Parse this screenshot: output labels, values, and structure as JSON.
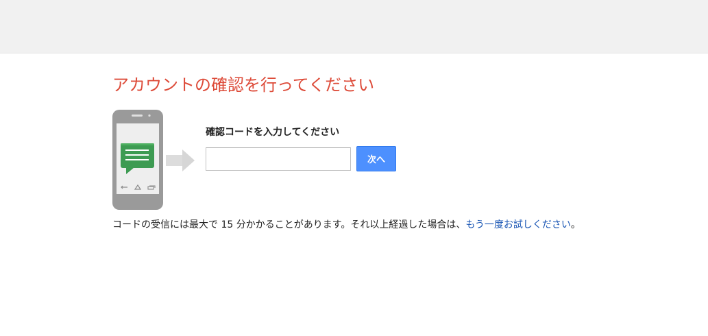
{
  "page": {
    "title": "アカウントの確認を行ってください"
  },
  "form": {
    "prompt_label": "確認コードを入力してください",
    "code_input_value": "",
    "code_input_placeholder": "",
    "next_label": "次へ"
  },
  "info": {
    "message": "コードの受信には最大で 15 分かかることがあります。それ以上経過した場合は、",
    "retry_link": "もう一度お試しください",
    "trailing": "。"
  },
  "illustration": {
    "icons": [
      "phone-icon",
      "chat-bubble-icon",
      "arrow-right-icon",
      "back-icon",
      "home-icon",
      "recent-apps-icon"
    ]
  },
  "colors": {
    "title": "#dd4b39",
    "button": "#4d90fe",
    "link": "#1a56b4",
    "top_bar": "#f1f1f1"
  }
}
